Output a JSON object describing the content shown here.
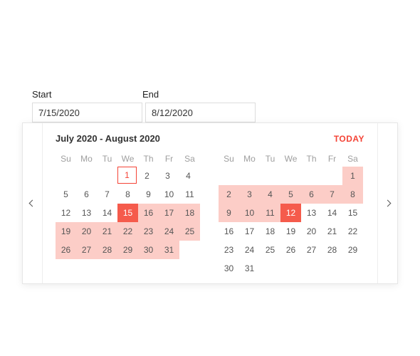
{
  "labels": {
    "start": "Start",
    "end": "End"
  },
  "inputs": {
    "start": "7/15/2020",
    "end": "8/12/2020"
  },
  "popup": {
    "title": "July 2020 - August 2020",
    "today_label": "TODAY",
    "dow": [
      "Su",
      "Mo",
      "Tu",
      "We",
      "Th",
      "Fr",
      "Sa"
    ],
    "months": [
      {
        "weeks": [
          [
            {
              "t": "",
              "s": "empty"
            },
            {
              "t": "",
              "s": "empty"
            },
            {
              "t": "",
              "s": "empty"
            },
            {
              "t": "1",
              "s": "today-outline"
            },
            {
              "t": "2",
              "s": ""
            },
            {
              "t": "3",
              "s": ""
            },
            {
              "t": "4",
              "s": ""
            }
          ],
          [
            {
              "t": "5",
              "s": ""
            },
            {
              "t": "6",
              "s": ""
            },
            {
              "t": "7",
              "s": ""
            },
            {
              "t": "8",
              "s": ""
            },
            {
              "t": "9",
              "s": ""
            },
            {
              "t": "10",
              "s": ""
            },
            {
              "t": "11",
              "s": ""
            }
          ],
          [
            {
              "t": "12",
              "s": ""
            },
            {
              "t": "13",
              "s": ""
            },
            {
              "t": "14",
              "s": ""
            },
            {
              "t": "15",
              "s": "selected"
            },
            {
              "t": "16",
              "s": "in-range"
            },
            {
              "t": "17",
              "s": "in-range"
            },
            {
              "t": "18",
              "s": "in-range"
            }
          ],
          [
            {
              "t": "19",
              "s": "in-range"
            },
            {
              "t": "20",
              "s": "in-range"
            },
            {
              "t": "21",
              "s": "in-range"
            },
            {
              "t": "22",
              "s": "in-range"
            },
            {
              "t": "23",
              "s": "in-range"
            },
            {
              "t": "24",
              "s": "in-range"
            },
            {
              "t": "25",
              "s": "in-range"
            }
          ],
          [
            {
              "t": "26",
              "s": "in-range"
            },
            {
              "t": "27",
              "s": "in-range"
            },
            {
              "t": "28",
              "s": "in-range"
            },
            {
              "t": "29",
              "s": "in-range"
            },
            {
              "t": "30",
              "s": "in-range"
            },
            {
              "t": "31",
              "s": "in-range"
            },
            {
              "t": "",
              "s": "empty"
            }
          ]
        ]
      },
      {
        "weeks": [
          [
            {
              "t": "",
              "s": "empty"
            },
            {
              "t": "",
              "s": "empty"
            },
            {
              "t": "",
              "s": "empty"
            },
            {
              "t": "",
              "s": "empty"
            },
            {
              "t": "",
              "s": "empty"
            },
            {
              "t": "",
              "s": "empty"
            },
            {
              "t": "1",
              "s": "in-range"
            }
          ],
          [
            {
              "t": "2",
              "s": "in-range"
            },
            {
              "t": "3",
              "s": "in-range"
            },
            {
              "t": "4",
              "s": "in-range"
            },
            {
              "t": "5",
              "s": "in-range"
            },
            {
              "t": "6",
              "s": "in-range"
            },
            {
              "t": "7",
              "s": "in-range"
            },
            {
              "t": "8",
              "s": "in-range"
            }
          ],
          [
            {
              "t": "9",
              "s": "in-range"
            },
            {
              "t": "10",
              "s": "in-range"
            },
            {
              "t": "11",
              "s": "in-range"
            },
            {
              "t": "12",
              "s": "selected"
            },
            {
              "t": "13",
              "s": ""
            },
            {
              "t": "14",
              "s": ""
            },
            {
              "t": "15",
              "s": ""
            }
          ],
          [
            {
              "t": "16",
              "s": ""
            },
            {
              "t": "17",
              "s": ""
            },
            {
              "t": "18",
              "s": ""
            },
            {
              "t": "19",
              "s": ""
            },
            {
              "t": "20",
              "s": ""
            },
            {
              "t": "21",
              "s": ""
            },
            {
              "t": "22",
              "s": ""
            }
          ],
          [
            {
              "t": "23",
              "s": ""
            },
            {
              "t": "24",
              "s": ""
            },
            {
              "t": "25",
              "s": ""
            },
            {
              "t": "26",
              "s": ""
            },
            {
              "t": "27",
              "s": ""
            },
            {
              "t": "28",
              "s": ""
            },
            {
              "t": "29",
              "s": ""
            }
          ],
          [
            {
              "t": "30",
              "s": ""
            },
            {
              "t": "31",
              "s": ""
            },
            {
              "t": "",
              "s": "empty"
            },
            {
              "t": "",
              "s": "empty"
            },
            {
              "t": "",
              "s": "empty"
            },
            {
              "t": "",
              "s": "empty"
            },
            {
              "t": "",
              "s": "empty"
            }
          ]
        ]
      }
    ]
  }
}
